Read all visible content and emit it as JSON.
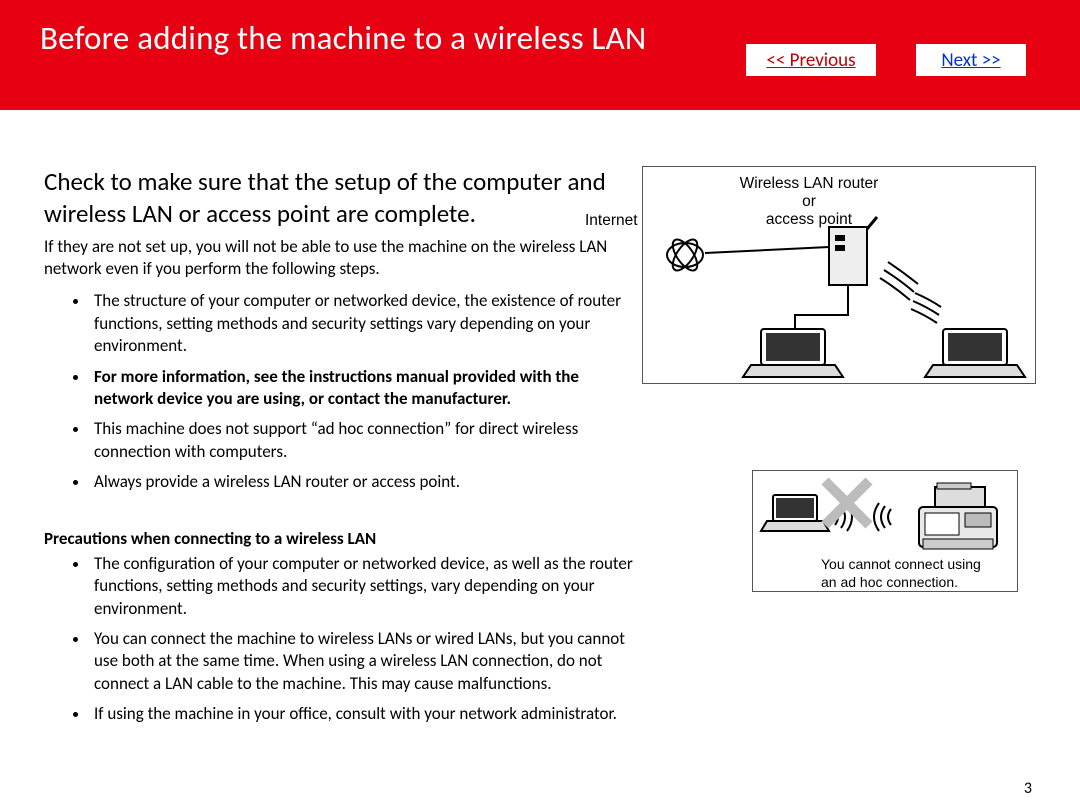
{
  "header": {
    "title": "Before adding the machine to a wireless LAN",
    "prev_label": "<< Previous",
    "next_label": "Next >>"
  },
  "main": {
    "intro_heading": "Check to make sure that the setup of the computer and wireless LAN or access point are complete.",
    "intro_sub": "If they are not set up, you will not be able to use the machine on the wireless LAN network even if you perform the following steps.",
    "bullets1": [
      "The structure of your computer or networked device, the existence of router functions, setting methods and security settings vary depending on your environment.",
      "For more information, see the instructions manual provided with the network device you are using, or contact the manufacturer.",
      "This machine does not support “ad hoc connection” for direct wireless connection with computers.",
      "Always provide a wireless LAN router or access point."
    ],
    "subheading": "Precautions when connecting to a wireless LAN",
    "bullets2": [
      "The configuration of your computer or networked device, as well as the router functions, setting methods and security settings, vary depending on your environment.",
      "You can connect the machine to wireless LANs or wired LANs, but you cannot use both at the same time. When using a wireless LAN connection, do not connect a LAN cable to the machine. This may cause malfunctions.",
      "If using the machine in your office, consult with your network administrator."
    ]
  },
  "diagram1": {
    "label_internet": "Internet",
    "label_router_l1": "Wireless LAN router",
    "label_router_l2": "or",
    "label_router_l3": "access point"
  },
  "diagram2": {
    "caption_l1": "You cannot connect using",
    "caption_l2": "an ad hoc connection."
  },
  "page_number": "3"
}
